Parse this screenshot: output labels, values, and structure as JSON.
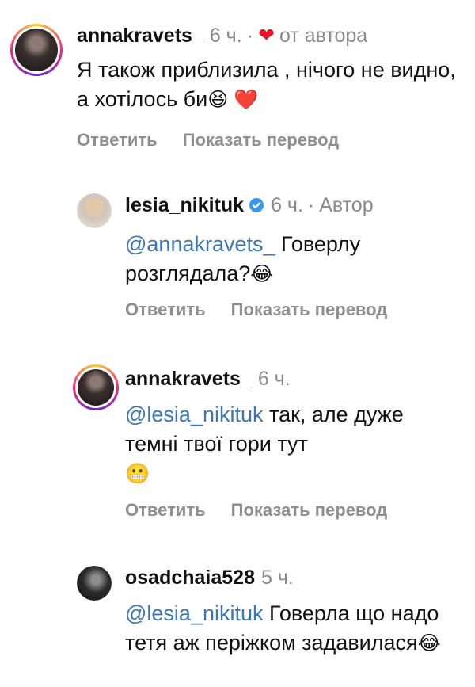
{
  "comments": [
    {
      "username": "annakravets_",
      "time": "6 ч.",
      "liked_by_author": "от автора",
      "text": "Я також приблизила , нічого не видно, а хотілось би",
      "emoji": "😆 ❤️",
      "reply": "Ответить",
      "translate": "Показать перевод"
    },
    {
      "username": "lesia_nikituk",
      "time": "6 ч.",
      "badge": "Автор",
      "mention": "@annakravets_",
      "text": " Говерлу розглядала?",
      "emoji": "😂",
      "reply": "Ответить",
      "translate": "Показать перевод"
    },
    {
      "username": "annakravets_",
      "time": "6 ч.",
      "mention": "@lesia_nikituk",
      "text": " так, але дуже темні твої гори тут",
      "emoji": "😬",
      "reply": "Ответить",
      "translate": "Показать перевод"
    },
    {
      "username": "osadchaia528",
      "time": "5 ч.",
      "mention": "@lesia_nikituk",
      "text": " Говерла що надо тетя аж періжком задавилася",
      "emoji": "😂"
    }
  ],
  "icons": {
    "heart": "heart-icon",
    "verified": "verified-badge-icon"
  },
  "colors": {
    "mention": "#3b76b8",
    "heart": "#e0162b",
    "muted": "#8a8a8a"
  }
}
